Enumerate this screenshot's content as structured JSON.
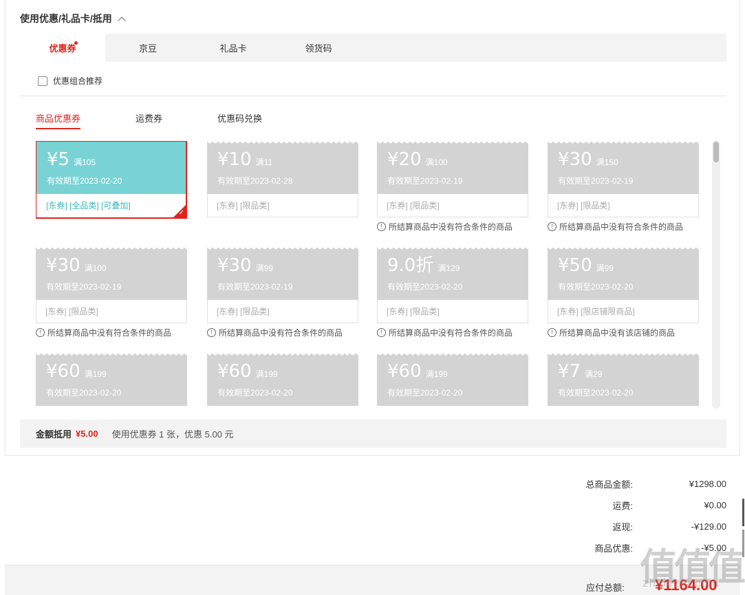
{
  "section": {
    "title": "使用优惠/礼品卡/抵用"
  },
  "tabs": [
    {
      "label": "优惠券",
      "active": true
    },
    {
      "label": "京豆",
      "active": false
    },
    {
      "label": "礼品卡",
      "active": false
    },
    {
      "label": "领货码",
      "active": false
    }
  ],
  "combo": {
    "label": "优惠组合推荐",
    "checked": false
  },
  "subtabs": [
    {
      "label": "商品优惠券",
      "active": true
    },
    {
      "label": "运费券",
      "active": false
    },
    {
      "label": "优惠码兑换",
      "active": false
    }
  ],
  "coupons": [
    {
      "amount": "¥5",
      "min": "满105",
      "date": "有效期至2023-02-20",
      "tags": "[东券] [全品类] [可叠加]",
      "note": "",
      "selected": true
    },
    {
      "amount": "¥10",
      "min": "满11",
      "date": "有效期至2023-02-28",
      "tags": "[东券] [限品类]",
      "note": "",
      "selected": false
    },
    {
      "amount": "¥20",
      "min": "满100",
      "date": "有效期至2023-02-19",
      "tags": "[东券] [限品类]",
      "note": "所结算商品中没有符合条件的商品",
      "selected": false
    },
    {
      "amount": "¥30",
      "min": "满150",
      "date": "有效期至2023-02-19",
      "tags": "[东券] [限品类]",
      "note": "所结算商品中没有符合条件的商品",
      "selected": false
    },
    {
      "amount": "¥30",
      "min": "满100",
      "date": "有效期至2023-02-19",
      "tags": "[东券] [限品类]",
      "note": "所结算商品中没有符合条件的商品",
      "selected": false
    },
    {
      "amount": "¥30",
      "min": "满99",
      "date": "有效期至2023-02-19",
      "tags": "[东券] [限品类]",
      "note": "所结算商品中没有符合条件的商品",
      "selected": false
    },
    {
      "amount": "9.0折",
      "min": "满129",
      "date": "有效期至2023-02-20",
      "tags": "[东券] [限品类]",
      "note": "所结算商品中没有符合条件的商品",
      "selected": false
    },
    {
      "amount": "¥50",
      "min": "满99",
      "date": "有效期至2023-02-20",
      "tags": "[东券] [限店铺限商品]",
      "note": "所结算商品中没有该店铺的商品",
      "selected": false
    },
    {
      "amount": "¥60",
      "min": "满199",
      "date": "有效期至2023-02-20",
      "tags": "",
      "note": "",
      "selected": false
    },
    {
      "amount": "¥60",
      "min": "满199",
      "date": "有效期至2023-02-20",
      "tags": "",
      "note": "",
      "selected": false
    },
    {
      "amount": "¥60",
      "min": "满199",
      "date": "有效期至2023-02-20",
      "tags": "",
      "note": "",
      "selected": false
    },
    {
      "amount": "¥7",
      "min": "满29",
      "date": "有效期至2023-02-20",
      "tags": "",
      "note": "",
      "selected": false
    }
  ],
  "summary": {
    "label": "金额抵用",
    "amount": "¥5.00",
    "text": "使用优惠券 1 张，优惠 5.00 元"
  },
  "totals": [
    {
      "label": "总商品金额:",
      "value": "¥1298.00"
    },
    {
      "label": "运费:",
      "value": "¥0.00"
    },
    {
      "label": "返现:",
      "value": "-¥129.00"
    },
    {
      "label": "商品优惠:",
      "value": "-¥5.00"
    }
  ],
  "payable": {
    "label": "应付总额:",
    "value": "¥1164.00"
  },
  "watermark": {
    "logo": "值值值",
    "url": "zhidezhi.com"
  },
  "colors": {
    "accent": "#e2231a",
    "selected_coupon": "#79d3d5",
    "disabled_coupon": "#d3d3d3"
  }
}
